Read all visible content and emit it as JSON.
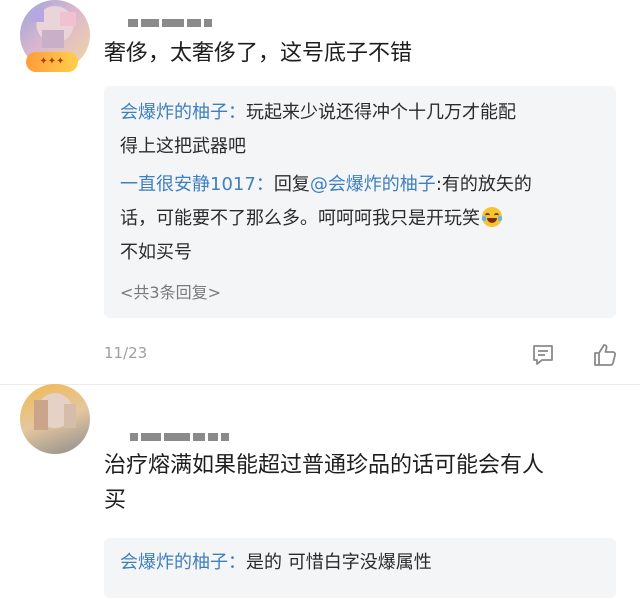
{
  "comments": [
    {
      "text": "奢侈，太奢侈了，这号底子不错",
      "replies": [
        {
          "user": "会爆炸的柚子",
          "sep": "：",
          "line1": "玩起来少说还得冲个十几万才能配",
          "line2": "得上这把武器吧"
        },
        {
          "user": "一直很安静1017",
          "sep": "：",
          "prefix": "回复",
          "mention": "@会爆炸的柚子",
          "line1_after": ":有的放矢的",
          "line2": "话，可能要不了那么多。呵呵呵我只是开玩笑",
          "line3": "不如买号"
        }
      ],
      "more_replies": "<共3条回复>",
      "date": "11/23"
    },
    {
      "text_line1": "治疗熔满如果能超过普通珍品的话可能会有人",
      "text_line2": "买",
      "replies": [
        {
          "user": "会爆炸的柚子",
          "sep": "：",
          "text": "是的 可惜白字没爆属性"
        }
      ]
    }
  ],
  "icons": {
    "reply": "comment-icon",
    "like": "thumbs-up-icon",
    "emoji": "laughing-tears-emoji"
  },
  "colors": {
    "username": "#3f7fbf",
    "reply_bg": "#f4f5f7",
    "meta": "#a0a0a0"
  }
}
